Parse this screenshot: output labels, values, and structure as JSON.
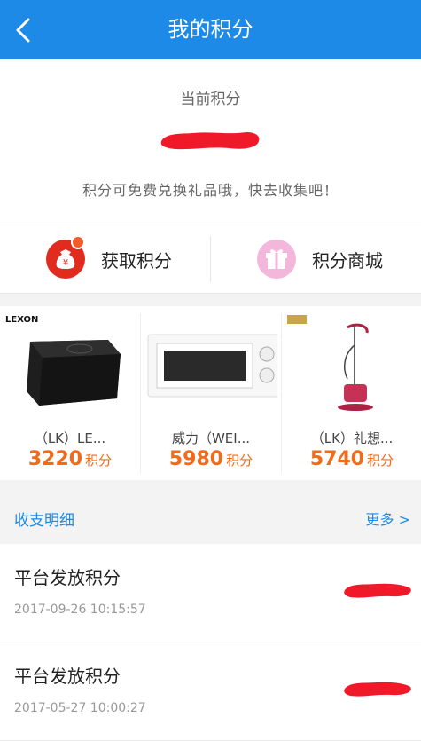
{
  "header": {
    "title": "我的积分"
  },
  "points": {
    "label": "当前积分",
    "hint": "积分可免费兑换礼品哦，快去收集吧！"
  },
  "actions": [
    {
      "label": "获取积分",
      "icon": "money-bag-icon"
    },
    {
      "label": "积分商城",
      "icon": "gift-icon"
    }
  ],
  "products": [
    {
      "name": "（LK）LE...",
      "price": "3220",
      "unit": "积分",
      "brand": "LEXON"
    },
    {
      "name": "威力（WEI...",
      "price": "5980",
      "unit": "积分"
    },
    {
      "name": "（LK）礼想...",
      "price": "5740",
      "unit": "积分"
    }
  ],
  "records_header": {
    "title": "收支明细",
    "more": "更多 >"
  },
  "records": [
    {
      "name": "平台发放积分",
      "time": "2017-09-26 10:15:57"
    },
    {
      "name": "平台发放积分",
      "time": "2017-05-27 10:00:27"
    }
  ],
  "colors": {
    "primary": "#1c8ae6",
    "price": "#f26b1b"
  }
}
